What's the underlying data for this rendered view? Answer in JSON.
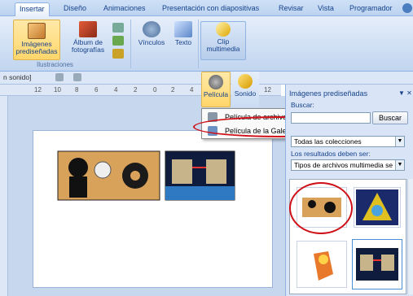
{
  "tabs": [
    "Insertar",
    "Diseño",
    "Animaciones",
    "Presentación con diapositivas",
    "Revisar",
    "Vista",
    "Programador"
  ],
  "active_tab": "Insertar",
  "ribbon": {
    "imagenes_label": "Imágenes prediseñadas",
    "album_label": "Álbum de fotografías",
    "group_label": "Ilustraciones",
    "vinculos_label": "Vínculos",
    "texto_label": "Texto",
    "clip_label": "Clip multimedia"
  },
  "qat": {
    "partial_text": "n sonido]"
  },
  "ruler_numbers": [
    "12",
    "10",
    "8",
    "6",
    "4",
    "2",
    "0",
    "2",
    "4",
    "12"
  ],
  "media_buttons": {
    "pelicula": "Película",
    "sonido": "Sonido"
  },
  "dropdown_menu": {
    "item1": "Película de archivo...",
    "item2": "Película de la Galería multimedia..."
  },
  "pane": {
    "title": "Imágenes prediseñadas",
    "buscar_label": "Buscar:",
    "buscar_button": "Buscar",
    "collections_value": "Todas las colecciones",
    "results_label": "Los resultados deben ser:",
    "results_value": "Tipos de archivos multimedia se"
  },
  "colors": {
    "accent": "#15428b",
    "highlight": "#ffd66b",
    "annotation": "#d01018"
  }
}
